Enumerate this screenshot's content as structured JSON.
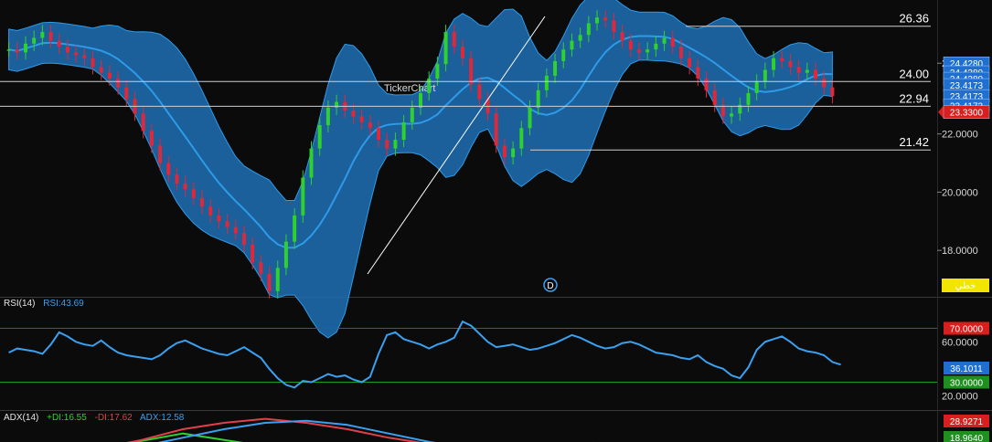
{
  "colors": {
    "background": "#0b0b0b",
    "band_fill": "#1f6fb5",
    "band_line": "#2d9be8",
    "candle_up": "#2fd12f",
    "candle_down": "#e0283a",
    "rsi_line": "#3aa0f0",
    "rsi_upper": "#d01f1f",
    "rsi_lower": "#1f9b1f",
    "adx_plus": "#2fd12f",
    "adx_minus": "#e0404a",
    "adx_line": "#3aa0f0",
    "price_tag_blue": "#1f6fd0",
    "price_tag_red": "#d91e1e",
    "label_yellow": "#f2e500"
  },
  "main_panel": {
    "watermark": "TickerChart",
    "event_marker": "D",
    "language_badge": "خطي",
    "price_axis_ticks": [
      "24.4280",
      "22.0000",
      "20.0000",
      "18.0000"
    ],
    "price_axis_ticks_values": [
      24.428,
      22.0,
      20.0,
      18.0
    ],
    "price_tags": [
      {
        "label": "24.4280",
        "value": 24.428,
        "color": "blue"
      },
      {
        "label": "24.4280",
        "value": 24.12,
        "color": "blue"
      },
      {
        "label": "24.4280",
        "value": 23.9,
        "color": "blue"
      },
      {
        "label": "23.4173",
        "value": 23.68,
        "color": "blue"
      },
      {
        "label": "23.4173",
        "value": 23.3,
        "color": "blue"
      },
      {
        "label": "23.4173",
        "value": 22.98,
        "color": "blue"
      },
      {
        "label": "23.3300",
        "value": 22.75,
        "color": "red"
      }
    ],
    "horizontal_levels": [
      {
        "label": "26.36",
        "value": 25.7,
        "from": 0.69
      },
      {
        "label": "24.00",
        "value": 23.8,
        "from": 0.0
      },
      {
        "label": "22.94",
        "value": 22.95,
        "from": 0.0
      },
      {
        "label": "21.42",
        "value": 21.45,
        "from": 0.54
      }
    ]
  },
  "rsi_panel": {
    "title": "RSI(14)",
    "value_label": "RSI:43.69",
    "upper_label": "70.0000",
    "lower_label": "30.0000",
    "current_label": "36.1011",
    "tick_60": "60.0000",
    "tick_20": "20.0000"
  },
  "adx_panel": {
    "title": "ADX(14)",
    "plus_label": "+DI:16.55",
    "minus_label": "-DI:17.62",
    "adx_label": "ADX:12.58",
    "tag_red": "28.9271",
    "tag_green": "18.9640"
  },
  "chart_data": {
    "type": "candlestick",
    "ylim": [
      16.5,
      26.6
    ],
    "closes": [
      24.9,
      24.8,
      25.1,
      25.3,
      25.5,
      25.2,
      25.0,
      24.8,
      24.7,
      24.6,
      24.3,
      24.1,
      23.9,
      23.6,
      23.2,
      22.7,
      22.1,
      21.6,
      21.0,
      20.6,
      20.3,
      20.1,
      19.8,
      19.5,
      19.2,
      19.0,
      18.8,
      18.6,
      18.2,
      17.6,
      17.2,
      16.6,
      17.4,
      18.3,
      19.2,
      20.5,
      21.5,
      22.3,
      22.9,
      23.1,
      22.8,
      22.6,
      22.4,
      22.2,
      21.8,
      21.5,
      21.8,
      22.4,
      22.9,
      23.4,
      23.9,
      24.4,
      25.5,
      25.0,
      24.6,
      23.7,
      23.2,
      22.7,
      21.6,
      21.2,
      21.5,
      22.2,
      22.9,
      23.5,
      24.0,
      24.5,
      24.9,
      25.2,
      25.4,
      25.8,
      26.0,
      25.9,
      25.5,
      25.2,
      24.9,
      24.8,
      24.9,
      25.1,
      25.3,
      25.0,
      24.6,
      24.3,
      23.9,
      23.5,
      23.0,
      22.6,
      22.7,
      23.0,
      23.4,
      23.8,
      24.2,
      24.6,
      24.5,
      24.3,
      24.1,
      24.2,
      23.9,
      23.6,
      23.3
    ],
    "rsi": [
      52,
      55,
      54,
      53,
      51,
      58,
      67,
      64,
      60,
      58,
      57,
      61,
      56,
      52,
      50,
      49,
      48,
      47,
      50,
      55,
      59,
      61,
      58,
      55,
      53,
      51,
      50,
      53,
      56,
      52,
      48,
      40,
      33,
      28,
      26,
      31,
      30,
      33,
      36,
      34,
      35,
      32,
      30,
      34,
      51,
      65,
      67,
      62,
      60,
      58,
      55,
      58,
      60,
      63,
      75,
      72,
      66,
      60,
      56,
      57,
      58,
      56,
      54,
      55,
      57,
      59,
      62,
      65,
      63,
      60,
      57,
      55,
      56,
      59,
      60,
      58,
      55,
      52,
      51,
      50,
      48,
      47,
      50,
      45,
      42,
      40,
      35,
      33,
      41,
      54,
      60,
      62,
      64,
      60,
      55,
      53,
      52,
      50,
      45,
      43
    ],
    "series": [
      {
        "name": "+DI",
        "values": [
          14.5,
          15.0,
          16.0,
          18.5,
          22.0,
          19.0,
          16.0,
          14.0,
          12.0,
          11.0,
          12.5,
          13.5,
          15.0,
          16.2,
          16.55
        ]
      },
      {
        "name": "-DI",
        "values": [
          12.0,
          13.0,
          15.0,
          19.0,
          24.0,
          27.0,
          28.9,
          27.0,
          24.0,
          20.0,
          17.0,
          15.0,
          14.5,
          16.0,
          17.62
        ]
      },
      {
        "name": "ADX",
        "values": [
          10.0,
          11.0,
          13.0,
          16.0,
          20.0,
          24.0,
          27.0,
          28.0,
          26.0,
          22.0,
          18.0,
          15.0,
          13.5,
          12.8,
          12.58
        ]
      }
    ]
  }
}
